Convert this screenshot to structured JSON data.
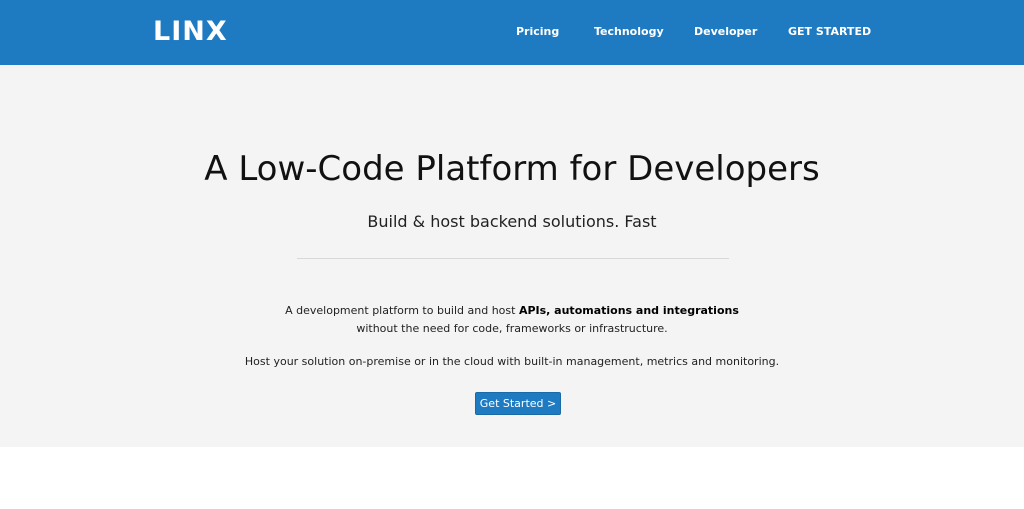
{
  "brand": {
    "name": "LINX"
  },
  "nav": {
    "pricing": "Pricing",
    "technology": "Technology",
    "developer": "Developer",
    "get_started": "GET STARTED"
  },
  "hero": {
    "title": "A Low-Code Platform for Developers",
    "subtitle": "Build & host backend solutions. Fast",
    "desc_line1_prefix": "A development platform to build and host ",
    "desc_line1_bold": "APIs, automations and integrations",
    "desc_line2": "without the need for code, frameworks or infrastructure.",
    "desc_line3": "Host your solution on-premise or in the cloud with built-in management, metrics and monitoring.",
    "cta_label": "Get Started >"
  },
  "colors": {
    "brand_blue": "#1f7bc1",
    "hero_bg": "#f4f4f4"
  }
}
